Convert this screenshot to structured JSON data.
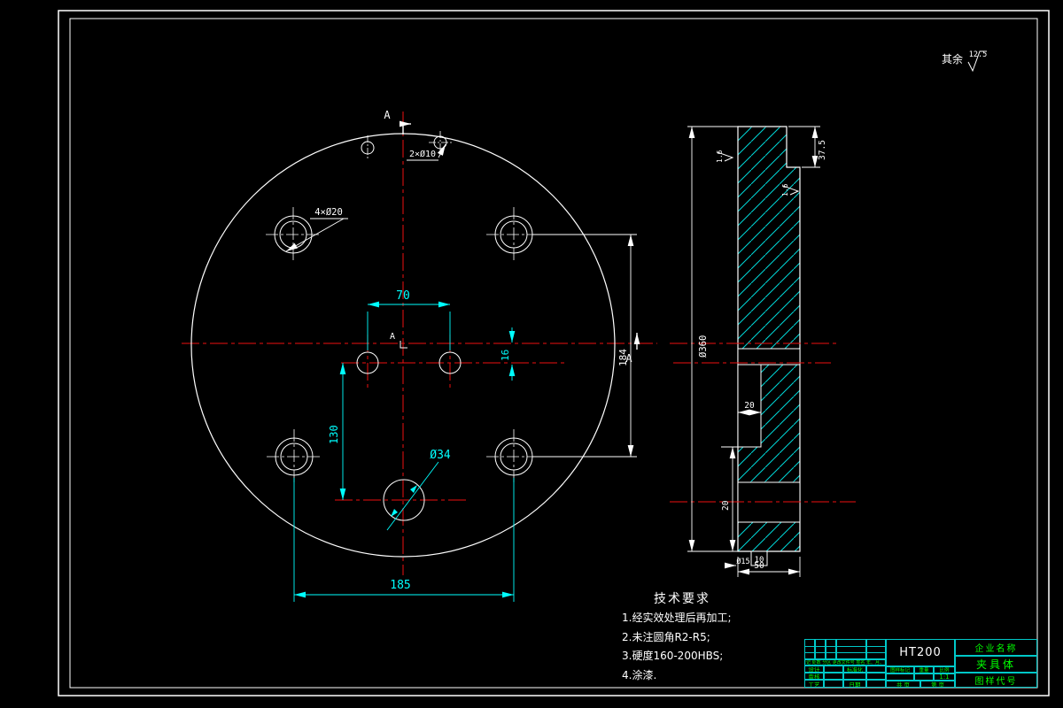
{
  "colors": {
    "background": "#000000",
    "outline": "#ffffff",
    "dimension": "#00ffff",
    "centerline": "#ee1111",
    "titleblock_text": "#00ff00"
  },
  "surface_note": {
    "prefix": "其余",
    "value": "12.5"
  },
  "front_view": {
    "section_label": "A",
    "dims": {
      "width_70": "70",
      "offset_16": "16",
      "height_130": "130",
      "width_185": "185",
      "height_184": "184",
      "hole_d34": "Ø34",
      "holes_4xd20": "4×Ø20",
      "holes_2xd10": "2×Ø10"
    }
  },
  "side_view": {
    "roughness": "1.6",
    "dims": {
      "d360": "Ø360",
      "depth_37_5": "37.5",
      "bore_depth_20": "20",
      "height_20": "20",
      "d15": "Ø15",
      "w10": "10",
      "thk_50": "50"
    }
  },
  "tech_req": {
    "title": "技术要求",
    "items": [
      "1.经实效处理后再加工;",
      "2.未注圆角R2-R5;",
      "3.硬度160-200HBS;",
      "4.涂漆."
    ]
  },
  "title_block": {
    "material": "HT200",
    "company": "企业名称",
    "part": "夹具体",
    "code": "图样代号",
    "rev_row": "标记 处数 分区 更改文件号 签名 年、月、日",
    "design": "设计",
    "check": "审核",
    "process": "工艺",
    "standardization": "标准化",
    "date": "日期",
    "stamp": "图样标记",
    "weight": "重量",
    "scale": "比例",
    "scale_value": "1:1",
    "sheet_total_label": "共  页",
    "sheet_no_label": "第  页"
  }
}
